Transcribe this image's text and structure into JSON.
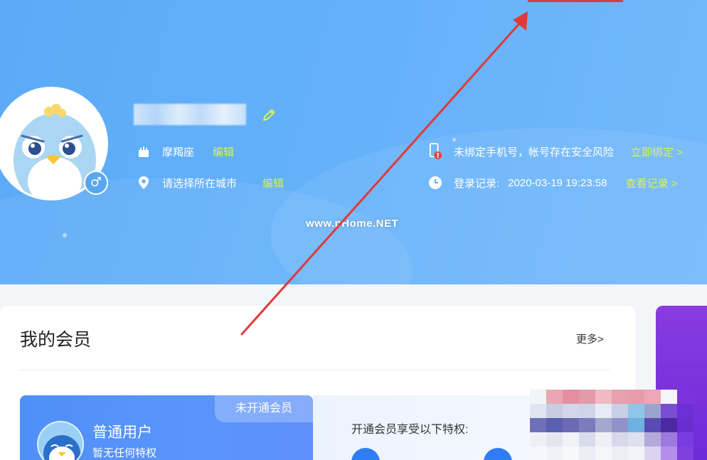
{
  "profile": {
    "zodiac": "摩羯座",
    "zodiac_edit": "编辑",
    "city": "请选择所在城市",
    "city_edit": "编辑",
    "gender_symbol": "♂",
    "gender_icon": "male-icon"
  },
  "security": {
    "phone_warning": "未绑定手机号，帐号存在安全风险",
    "bind_now": "立即绑定 >",
    "login_record_label": "登录记录:",
    "login_time": "2020-03-19 19:23:58",
    "view_records": "查看记录 >"
  },
  "watermark": "www.pHome.NET",
  "membership": {
    "title": "我的会员",
    "more": "更多>",
    "status_tag": "未开通会员",
    "level": "普通用户",
    "level_desc": "暂无任何特权",
    "privilege_title": "开通会员享受以下特权:"
  },
  "colors": {
    "header_blue": "#62aff9",
    "accent_yellow": "#d8f54a",
    "member_blue": "#4f8ff7",
    "purple": "#7b33dc",
    "annotation_red": "#e0393a"
  },
  "icons": [
    "pencil-icon",
    "castle-icon",
    "location-pin-icon",
    "phone-warning-icon",
    "clock-icon"
  ]
}
